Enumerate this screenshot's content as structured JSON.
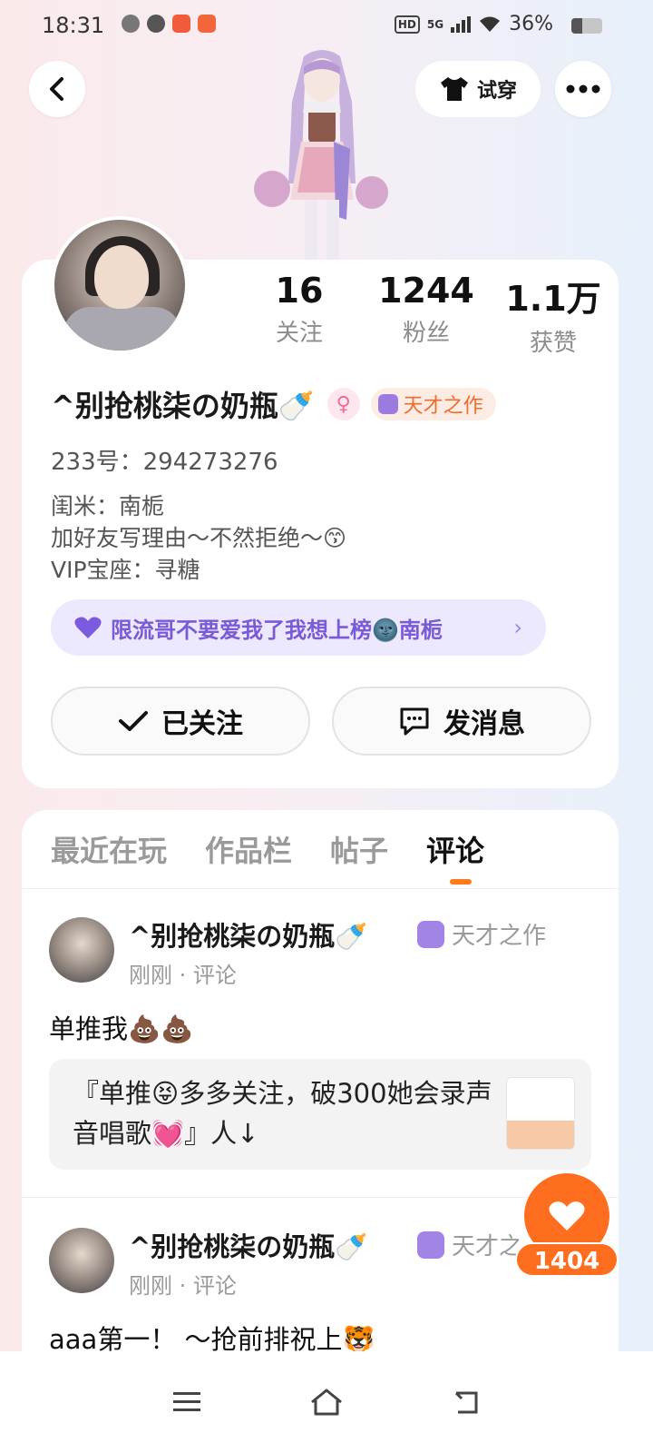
{
  "status_bar": {
    "time": "18:31",
    "network": "5G",
    "battery": "36%",
    "battery_level": 0.36
  },
  "header": {
    "try_on_label": "试穿"
  },
  "stats": [
    {
      "value": "16",
      "label": "关注"
    },
    {
      "value": "1244",
      "label": "粉丝"
    },
    {
      "value": "1.1万",
      "label": "获赞"
    }
  ],
  "profile": {
    "name": "^别抢桃柒の奶瓶🍼",
    "gender_symbol": "♀",
    "badge": "天才之作",
    "id_line": "233号：294273276",
    "bio": [
      "闺米：南栀",
      "加好友写理由～不然拒绝～😙",
      "VIP宝座：寻糖"
    ],
    "honor": "限流哥不要爱我了我想上榜🌚南栀"
  },
  "actions": {
    "follow": "已关注",
    "message": "发消息"
  },
  "tabs": [
    "最近在玩",
    "作品栏",
    "帖子",
    "评论"
  ],
  "posts": [
    {
      "name": "^别抢桃柒の奶瓶🍼",
      "badge": "天才之作",
      "meta": "刚刚 · 评论",
      "text": "单推我💩💩",
      "quote": "『单推😝多多关注，破300她会录声音唱歌💓』人↓"
    },
    {
      "name": "^别抢桃柒の奶瓶🍼",
      "badge": "天才之",
      "meta": "刚刚 · 评论",
      "text": "aaa第一！ ～抢前排祝上🐯"
    }
  ],
  "like_count": "1404"
}
